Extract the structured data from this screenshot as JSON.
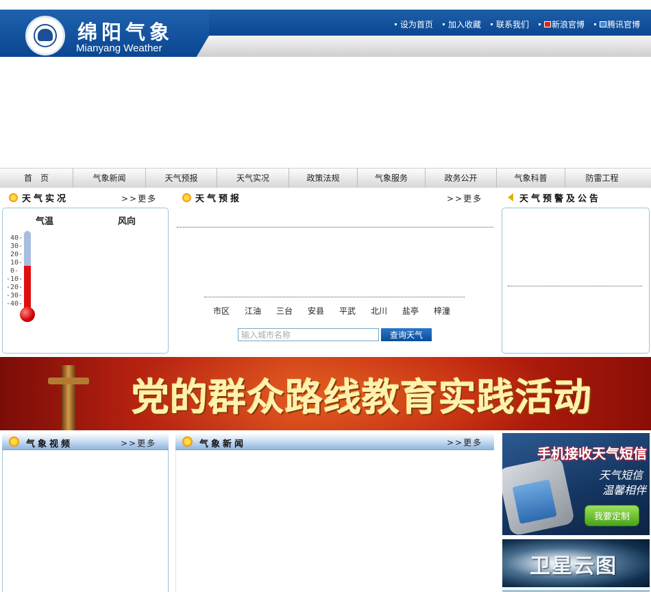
{
  "header": {
    "title_cn": "绵阳气象",
    "title_en": "Mianyang Weather",
    "links": [
      {
        "label": "设为首页",
        "icon": null
      },
      {
        "label": "加入收藏",
        "icon": null
      },
      {
        "label": "联系我们",
        "icon": null
      },
      {
        "label": "新浪官博",
        "icon": "sina-weibo-icon"
      },
      {
        "label": "腾讯官博",
        "icon": "tencent-weibo-icon"
      }
    ]
  },
  "nav": {
    "items": [
      "首　页",
      "气象新闻",
      "天气预报",
      "天气实况",
      "政策法规",
      "气象服务",
      "政务公开",
      "气象科普",
      "防雷工程"
    ]
  },
  "live": {
    "title": "天气实况",
    "more": ">>更多",
    "col_temp": "气温",
    "col_wind": "风向",
    "scale": [
      "40-",
      "30-",
      "20-",
      "10-",
      "0-",
      "-10-",
      "-20-",
      "-30-",
      "-40-"
    ],
    "thermometer_level": 0.6
  },
  "forecast": {
    "title": "天气预报",
    "more": ">>更多",
    "cities": [
      "市区",
      "江油",
      "三台",
      "安县",
      "平武",
      "北川",
      "盐亭",
      "梓潼"
    ],
    "search_placeholder": "输入城市名称",
    "search_button": "查询天气"
  },
  "warning": {
    "title": "天气预警及公告"
  },
  "banner": {
    "text": "党的群众路线教育实践活动"
  },
  "video": {
    "title": "气象视频",
    "more": ">>更多"
  },
  "news": {
    "title": "气象新闻",
    "more": ">>更多"
  },
  "ads": {
    "sms_heading": "手机接收天气短信",
    "sms_line1": "天气短信",
    "sms_line2": "温馨相伴",
    "sms_button": "我要定制",
    "satellite": "卫星云图"
  },
  "colors": {
    "brand_blue": "#0b4692",
    "panel_border": "#9cc3d8",
    "banner_red": "#b32010"
  }
}
